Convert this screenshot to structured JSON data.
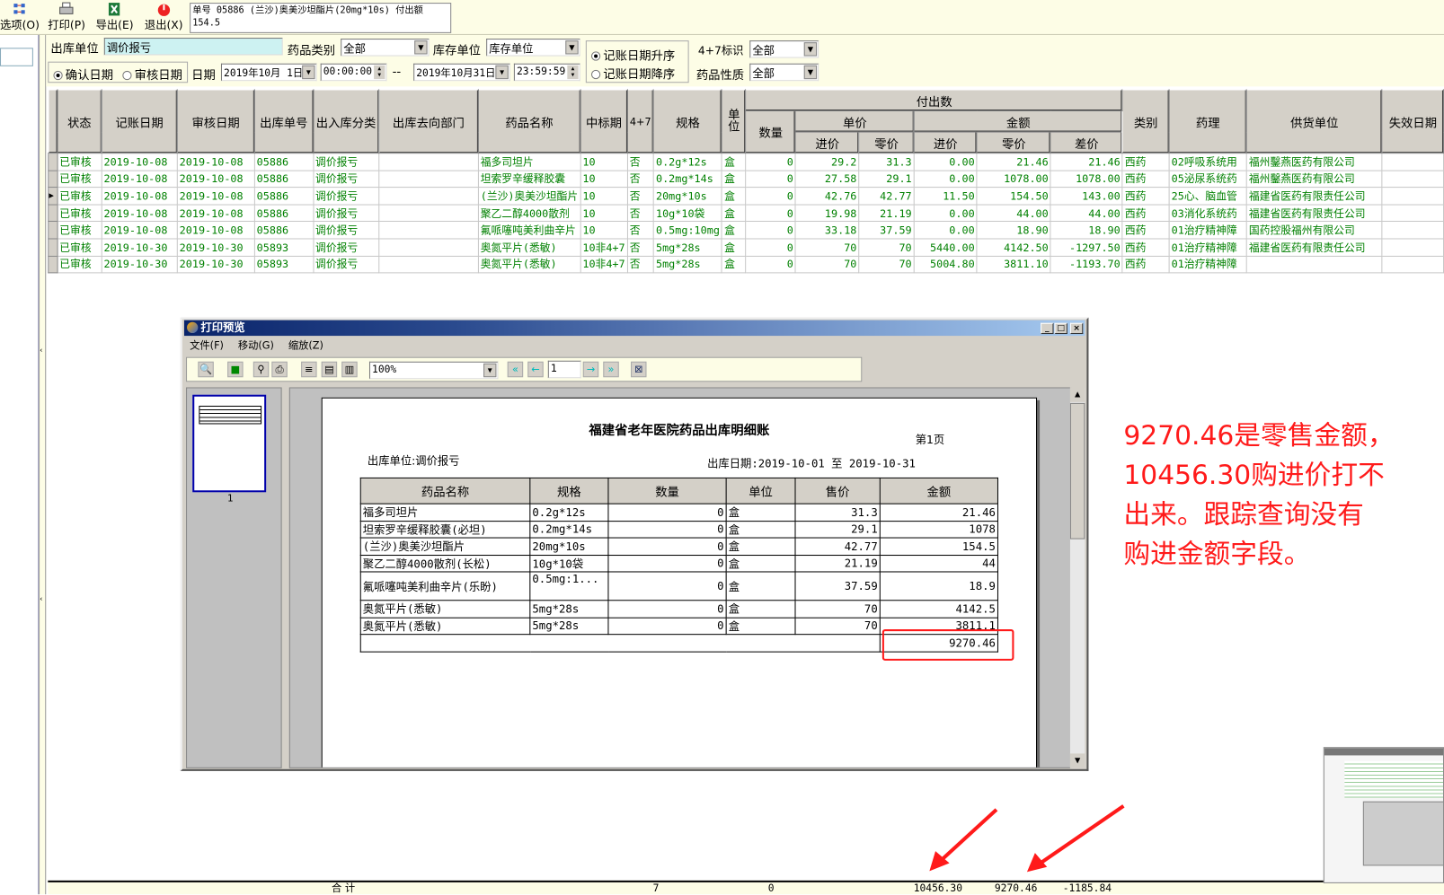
{
  "toolbar": {
    "buttons": [
      {
        "label": "选项(O)",
        "icon": "options-icon"
      },
      {
        "label": "打印(P)",
        "icon": "printer-icon"
      },
      {
        "label": "导出(E)",
        "icon": "excel-export-icon"
      },
      {
        "label": "退出(X)",
        "icon": "power-exit-icon"
      }
    ],
    "info_line1": "单号 05886  (兰沙)奥美沙坦酯片(20mg*10s) 付出额",
    "info_line2": "154.5"
  },
  "filters": {
    "outbound_unit_label": "出库单位",
    "outbound_unit_value": "调价报亏",
    "drug_category_label": "药品类别",
    "drug_category_value": "全部",
    "stock_unit_label": "库存单位",
    "stock_unit_value": "库存单位",
    "confirm_date_label": "确认日期",
    "audit_date_label": "审核日期",
    "date_type_selected": "确认日期",
    "date_label": "日期",
    "date_from": "2019年10月 1日",
    "time_from": "00:00:00",
    "dash": "--",
    "date_to": "2019年10月31日",
    "time_to": "23:59:59",
    "sort_asc_label": "记账日期升序",
    "sort_desc_label": "记账日期降序",
    "sort_selected": "记账日期升序",
    "flag47_label": "4+7标识",
    "flag47_value": "全部",
    "drug_nature_label": "药品性质",
    "drug_nature_value": "全部"
  },
  "grid": {
    "headers": {
      "status": "状态",
      "post_date": "记账日期",
      "audit_date": "审核日期",
      "order_no": "出库单号",
      "io_type": "出入库分类",
      "dest_dept": "出库去向部门",
      "drug_name": "药品名称",
      "bid_period": "中标期",
      "flag47": "4+7",
      "spec": "规格",
      "unit": "单位",
      "paid_out": "付出数",
      "qty": "数量",
      "unit_price": "单价",
      "amount": "金额",
      "purchase": "进价",
      "retail": "零价",
      "purchase2": "进价",
      "retail2": "零价",
      "diff": "差价",
      "category": "类别",
      "pharmacology": "药理",
      "supplier": "供货单位",
      "expiry": "失效日期"
    },
    "selected_row": 2,
    "rows": [
      [
        "已审核",
        "2019-10-08",
        "2019-10-08",
        "05886",
        "调价报亏",
        "",
        "福多司坦片",
        "10",
        "否",
        "0.2g*12s",
        "盒",
        "0",
        "29.2",
        "31.3",
        "0.00",
        "21.46",
        "21.46",
        "西药",
        "02呼吸系统用",
        "福州鑿燕医药有限公司",
        ""
      ],
      [
        "已审核",
        "2019-10-08",
        "2019-10-08",
        "05886",
        "调价报亏",
        "",
        "坦索罗辛缓释胶囊",
        "10",
        "否",
        "0.2mg*14s",
        "盒",
        "0",
        "27.58",
        "29.1",
        "0.00",
        "1078.00",
        "1078.00",
        "西药",
        "05泌尿系统药",
        "福州鑿燕医药有限公司",
        ""
      ],
      [
        "已审核",
        "2019-10-08",
        "2019-10-08",
        "05886",
        "调价报亏",
        "",
        "(兰沙)奥美沙坦酯片",
        "10",
        "否",
        "20mg*10s",
        "盒",
        "0",
        "42.76",
        "42.77",
        "11.50",
        "154.50",
        "143.00",
        "西药",
        "25心、脑血管",
        "福建省医药有限责任公司",
        ""
      ],
      [
        "已审核",
        "2019-10-08",
        "2019-10-08",
        "05886",
        "调价报亏",
        "",
        "聚乙二醇4000散剂",
        "10",
        "否",
        "10g*10袋",
        "盒",
        "0",
        "19.98",
        "21.19",
        "0.00",
        "44.00",
        "44.00",
        "西药",
        "03消化系统药",
        "福建省医药有限责任公司",
        ""
      ],
      [
        "已审核",
        "2019-10-08",
        "2019-10-08",
        "05886",
        "调价报亏",
        "",
        "氟哌噻吨美利曲辛片",
        "10",
        "否",
        "0.5mg:10mg",
        "盒",
        "0",
        "33.18",
        "37.59",
        "0.00",
        "18.90",
        "18.90",
        "西药",
        "01治疗精神障",
        "国药控股福州有限公司",
        ""
      ],
      [
        "已审核",
        "2019-10-30",
        "2019-10-30",
        "05893",
        "调价报亏",
        "",
        "奥氮平片(悉敏)",
        "10非4+7",
        "否",
        "5mg*28s",
        "盒",
        "0",
        "70",
        "70",
        "5440.00",
        "4142.50",
        "-1297.50",
        "西药",
        "01治疗精神障",
        "福建省医药有限责任公司",
        ""
      ],
      [
        "已审核",
        "2019-10-30",
        "2019-10-30",
        "05893",
        "调价报亏",
        "",
        "奥氮平片(悉敏)",
        "10非4+7",
        "否",
        "5mg*28s",
        "盒",
        "0",
        "70",
        "70",
        "5004.80",
        "3811.10",
        "-1193.70",
        "西药",
        "01治疗精神障",
        "",
        ""
      ]
    ],
    "footer": {
      "label": "合 计",
      "count": "7",
      "qty": "0",
      "purchase_total": "10456.30",
      "retail_total": "9270.46",
      "diff_total": "-1185.84"
    }
  },
  "preview": {
    "title": "打印预览",
    "menu": [
      "文件(F)",
      "移动(G)",
      "缩放(Z)"
    ],
    "zoom_value": "100%",
    "page_input": "1",
    "thumb_page_label": "1",
    "report": {
      "title": "福建省老年医院药品出库明细账",
      "page_label": "第1页",
      "unit_line": "出库单位:调价报亏",
      "date_line": "出库日期:2019-10-01 至 2019-10-31",
      "headers": [
        "药品名称",
        "规格",
        "数量",
        "单位",
        "售价",
        "金额"
      ],
      "rows": [
        [
          "福多司坦片",
          "0.2g*12s",
          "0",
          "盒",
          "31.3",
          "21.46"
        ],
        [
          "坦索罗辛缓释胶囊(必坦)",
          "0.2mg*14s",
          "0",
          "盒",
          "29.1",
          "1078"
        ],
        [
          "(兰沙)奥美沙坦酯片",
          "20mg*10s",
          "0",
          "盒",
          "42.77",
          "154.5"
        ],
        [
          "聚乙二醇4000散剂(长松)",
          "10g*10袋",
          "0",
          "盒",
          "21.19",
          "44"
        ],
        [
          "氟哌噻吨美利曲辛片(乐盼)",
          "0.5mg:1...",
          "0",
          "盒",
          "37.59",
          "18.9"
        ],
        [
          "奥氮平片(悉敏)",
          "5mg*28s",
          "0",
          "盒",
          "70",
          "4142.5"
        ],
        [
          "奥氮平片(悉敏)",
          "5mg*28s",
          "0",
          "盒",
          "70",
          "3811.1"
        ]
      ],
      "total": "9270.46"
    }
  },
  "annotation": {
    "lines": [
      "9270.46是零售金额，",
      "10456.30购进价打不",
      "出来。跟踪查询没有",
      "购进金额字段。"
    ],
    "color": "#ff1a1a"
  },
  "colors": {
    "grid_text": "#008000",
    "panel_bg": "#fdfde6",
    "header_bg": "#d4d0c8",
    "annotation": "#ff1a1a"
  }
}
